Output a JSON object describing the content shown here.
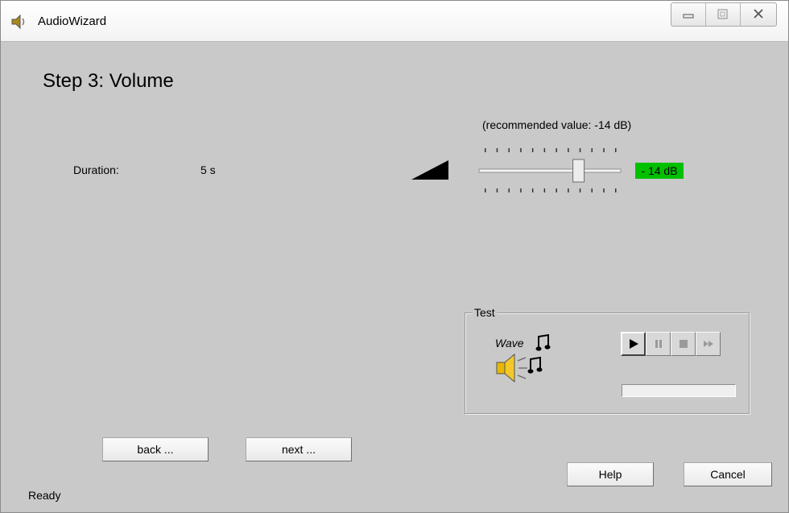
{
  "window": {
    "title": "AudioWizard",
    "icon": "speaker-icon",
    "controls": [
      "minimize-icon",
      "maximize-icon",
      "close-icon"
    ]
  },
  "step": {
    "title": "Step 3: Volume"
  },
  "duration": {
    "label": "Duration:",
    "value": "5 s"
  },
  "volume": {
    "recommended": "(recommended value: -14 dB)",
    "value_label": "- 14 dB",
    "slider_fraction": 0.72,
    "tick_count": 12,
    "badge_color": "#00c000"
  },
  "test": {
    "title": "Test",
    "wave_label": "Wave",
    "player_buttons": [
      "play-icon",
      "pause-icon",
      "stop-icon",
      "fast-forward-icon"
    ],
    "progress_fraction": 0
  },
  "buttons": {
    "back": "back ...",
    "next": "next ...",
    "help": "Help",
    "cancel": "Cancel"
  },
  "status": {
    "text": "Ready"
  }
}
